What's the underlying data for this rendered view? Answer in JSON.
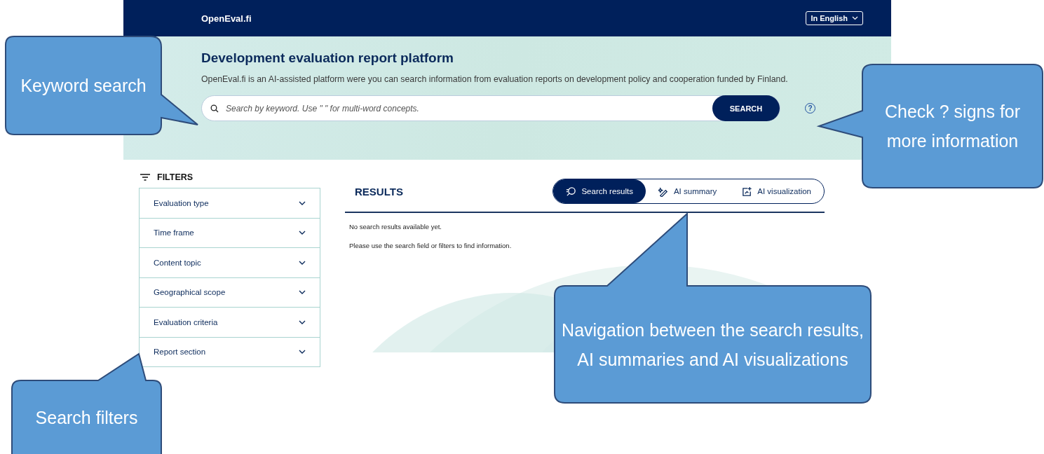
{
  "header": {
    "logo": "OpenEval.fi",
    "language": "In English"
  },
  "hero": {
    "title": "Development evaluation report platform",
    "description": "OpenEval.fi is an AI-assisted platform were you can search information from evaluation reports on development policy and cooperation funded by Finland.",
    "search": {
      "placeholder": "Search by keyword. Use \" \" for multi-word concepts.",
      "button": "SEARCH",
      "help": "?"
    }
  },
  "filters": {
    "title": "FILTERS",
    "items": [
      {
        "label": "Evaluation type",
        "expanded": false
      },
      {
        "label": "Time frame",
        "expanded": false
      },
      {
        "label": "Content topic",
        "expanded": false
      },
      {
        "label": "Geographical scope",
        "expanded": false
      },
      {
        "label": "Evaluation criteria",
        "expanded": false
      },
      {
        "label": "Report section",
        "expanded": false
      }
    ]
  },
  "results": {
    "title": "RESULTS",
    "tabs": [
      {
        "label": "Search results",
        "kind": "search",
        "selected": true
      },
      {
        "label": "AI summary",
        "kind": "summary",
        "selected": false
      },
      {
        "label": "AI visualization",
        "kind": "visualization",
        "selected": false
      }
    ],
    "messages": [
      "No search results available yet.",
      "Please use the search field or filters to find information."
    ]
  },
  "annotations": [
    {
      "text": "Keyword search"
    },
    {
      "text": "Check ? signs for more information"
    },
    {
      "text": "Navigation between the search results, AI summaries and AI visualizations"
    },
    {
      "text": "Search filters"
    }
  ]
}
